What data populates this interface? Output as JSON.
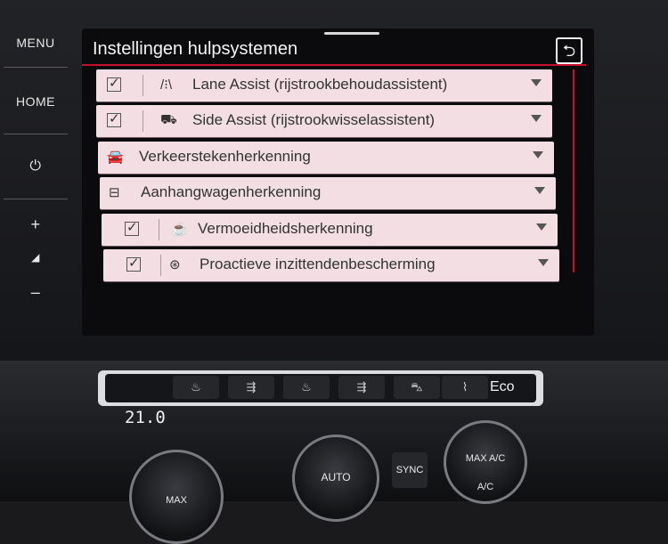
{
  "hardware_buttons": {
    "menu": "MENU",
    "home": "HOME",
    "power_icon": "power-icon",
    "vol_up": "+",
    "vol_down": "–"
  },
  "header": {
    "title": "Instellingen hulpsystemen",
    "back_icon": "back-arrow-icon"
  },
  "items": [
    {
      "label": "Lane Assist (rijstrookbehoudassistent)",
      "checkbox": true,
      "icon": "lane-assist-icon",
      "icon_glyph": "/⁝\\"
    },
    {
      "label": "Side Assist (rijstrookwisselassistent)",
      "checkbox": true,
      "icon": "side-assist-icon",
      "icon_glyph": "⛟"
    },
    {
      "label": "Verkeerstekenherkenning",
      "checkbox": false,
      "icon": "traffic-sign-icon",
      "icon_glyph": "🚘"
    },
    {
      "label": "Aanhangwagenherkenning",
      "checkbox": false,
      "icon": "trailer-icon",
      "icon_glyph": "⊟"
    },
    {
      "label": "Vermoeidheidsherkenning",
      "checkbox": true,
      "icon": "coffee-cup-icon",
      "icon_glyph": "☕"
    },
    {
      "label": "Proactieve inzittendenbescherming",
      "checkbox": true,
      "icon": "occupant-protection-icon",
      "icon_glyph": "⊛"
    }
  ],
  "climate": {
    "temperature": "21.0",
    "eco": "Eco",
    "auto": "AUTO",
    "sync": "SYNC",
    "max_ac": "MAX A/C",
    "ac": "A/C",
    "max": "MAX"
  },
  "colors": {
    "accent": "#c8102e",
    "row_bg": "#f3dfe3"
  }
}
